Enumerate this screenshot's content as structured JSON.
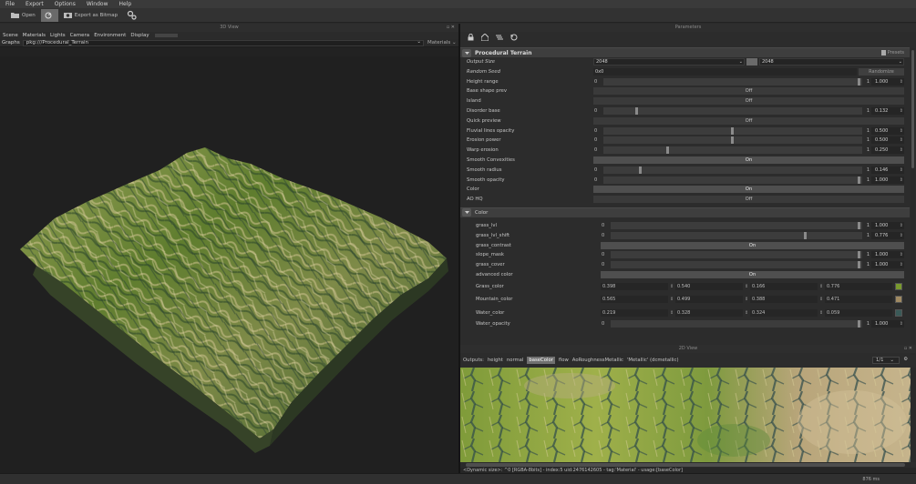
{
  "menu": [
    "File",
    "Export",
    "Options",
    "Window",
    "Help"
  ],
  "toolbar": {
    "open_label": "Open",
    "export_label": "Export as Bitmap"
  },
  "view3d": {
    "title": "3D View",
    "menu": [
      "Scene",
      "Materials",
      "Lights",
      "Camera",
      "Environment",
      "Display"
    ],
    "graph_label": "Graphs",
    "graph_value": "pkg:///Procedural_Terrain",
    "materials_label": "Materials"
  },
  "parameters": {
    "title": "Parameters",
    "section_main": "Procedural Terrain",
    "presets_label": "Presets",
    "output_size": {
      "label": "Output Size",
      "width": "2048",
      "height": "2048"
    },
    "random_seed": {
      "label": "Random Seed",
      "value": "0x0",
      "button": "Randomize"
    },
    "height_range": {
      "label": "Height range",
      "min": "0",
      "max": "1",
      "value": "1.000",
      "fraction": 0.99
    },
    "base_shape_prev": {
      "label": "Base shape prev",
      "value": "Off"
    },
    "island": {
      "label": "Island",
      "value": "Off"
    },
    "disorder_base": {
      "label": "Disorder base",
      "min": "0",
      "max": "1",
      "value": "0.132",
      "fraction": 0.132
    },
    "quick_preview": {
      "label": "Quick preview",
      "value": "Off"
    },
    "fluvial_lines_opacity": {
      "label": "Fluvial lines opacity",
      "min": "0",
      "max": "1",
      "value": "0.500",
      "fraction": 0.5
    },
    "erosion_power": {
      "label": "Erosion power",
      "min": "0",
      "max": "1",
      "value": "0.500",
      "fraction": 0.5
    },
    "warp_erosion": {
      "label": "Warp erosion",
      "min": "0",
      "max": "1",
      "value": "0.250",
      "fraction": 0.25
    },
    "smooth_convexities": {
      "label": "Smooth Convexities",
      "value": "On"
    },
    "smooth_radius": {
      "label": "Smooth radius",
      "min": "0",
      "max": "1",
      "value": "0.146",
      "fraction": 0.146
    },
    "smooth_opacity": {
      "label": "Smooth opacity",
      "min": "0",
      "max": "1",
      "value": "1.000",
      "fraction": 0.99
    },
    "color": {
      "label": "Color",
      "value": "On"
    },
    "ao_hq": {
      "label": "AO HQ",
      "value": "Off"
    },
    "section_color": "Color",
    "grass_lvl": {
      "label": "grass_lvl",
      "min": "0",
      "max": "1",
      "value": "1.000",
      "fraction": 0.99
    },
    "grass_lvl_shift": {
      "label": "grass_lvl_shift",
      "min": "0",
      "max": "1",
      "value": "0.776",
      "fraction": 0.776
    },
    "grass_contrast": {
      "label": "grass_contrast",
      "value": "On"
    },
    "slope_mask": {
      "label": "slope_mask",
      "min": "0",
      "max": "1",
      "value": "1.000",
      "fraction": 0.99
    },
    "grass_cover": {
      "label": "grass_cover",
      "min": "0",
      "max": "1",
      "value": "1.000",
      "fraction": 0.99
    },
    "advanced_color": {
      "label": "advanced color",
      "value": "On"
    },
    "grass_color": {
      "label": "Grass_color",
      "r": "0.398",
      "g": "0.540",
      "b": "0.166",
      "a": "0.776",
      "swatch": "#7a9a2e"
    },
    "mountain_color": {
      "label": "Mountain_color",
      "r": "0.565",
      "g": "0.499",
      "b": "0.388",
      "a": "0.471",
      "swatch": "#a08a62"
    },
    "water_color": {
      "label": "Water_color",
      "r": "0.219",
      "g": "0.328",
      "b": "0.324",
      "a": "0.059",
      "swatch": "#3a5a58"
    },
    "water_opacity": {
      "label": "Water_opacity",
      "min": "0",
      "max": "1",
      "value": "1.000",
      "fraction": 0.99
    }
  },
  "view2d": {
    "title": "2D View",
    "outputs_label": "Outputs:",
    "tabs": [
      "height",
      "normal",
      "baseColor",
      "flow",
      "AoRoughnessMetallic",
      "'Metallic' (dcmetallic)"
    ],
    "active_tab": "baseColor",
    "zoom": "1/1",
    "status": "<Dynamic size>: ^0 [RGBA-8bits] - index:5 uid:2476142605 - tag:'Material' - usage:[baseColor]"
  },
  "status": {
    "timing": "876 ms"
  }
}
